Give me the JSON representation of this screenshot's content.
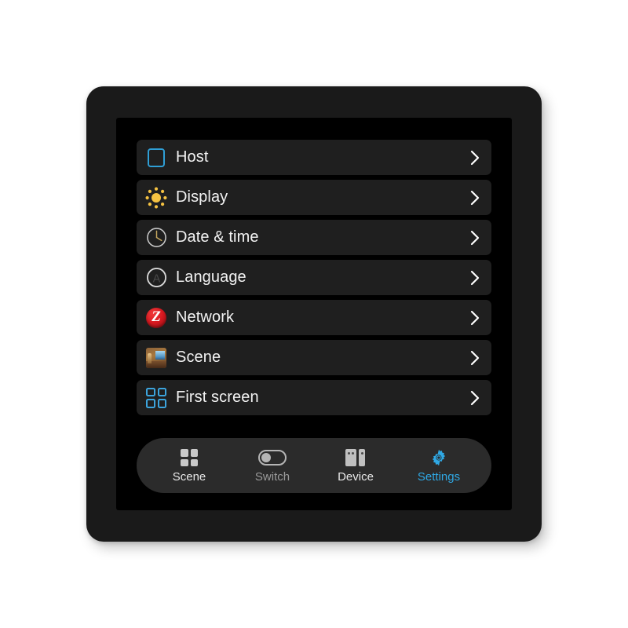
{
  "device": {
    "frame_color": "#1a1a1a",
    "screen_bg": "#000000",
    "accent_color": "#2fa8e4"
  },
  "settings_list": {
    "items": [
      {
        "id": "host",
        "label": "Host",
        "icon": "square-outline-icon",
        "chevron": "chevron-right-icon"
      },
      {
        "id": "display",
        "label": "Display",
        "icon": "sun-icon",
        "chevron": "chevron-right-icon"
      },
      {
        "id": "date-time",
        "label": "Date & time",
        "icon": "clock-icon",
        "chevron": "chevron-right-icon"
      },
      {
        "id": "language",
        "label": "Language",
        "icon": "letter-a-circle-icon",
        "chevron": "chevron-right-icon"
      },
      {
        "id": "network",
        "label": "Network",
        "icon": "zigbee-icon",
        "chevron": "chevron-right-icon"
      },
      {
        "id": "scene",
        "label": "Scene",
        "icon": "photo-thumbnail-icon",
        "chevron": "chevron-right-icon"
      },
      {
        "id": "first-screen",
        "label": "First screen",
        "icon": "grid-four-icon",
        "chevron": "chevron-right-icon"
      }
    ]
  },
  "navbar": {
    "items": [
      {
        "id": "scene",
        "label": "Scene",
        "icon": "grid-four-icon",
        "state": "normal"
      },
      {
        "id": "switch",
        "label": "Switch",
        "icon": "toggle-off-icon",
        "state": "dim"
      },
      {
        "id": "device",
        "label": "Device",
        "icon": "device-panel-icon",
        "state": "normal"
      },
      {
        "id": "settings",
        "label": "Settings",
        "icon": "gear-icon",
        "state": "active"
      }
    ],
    "active_item": "settings"
  }
}
